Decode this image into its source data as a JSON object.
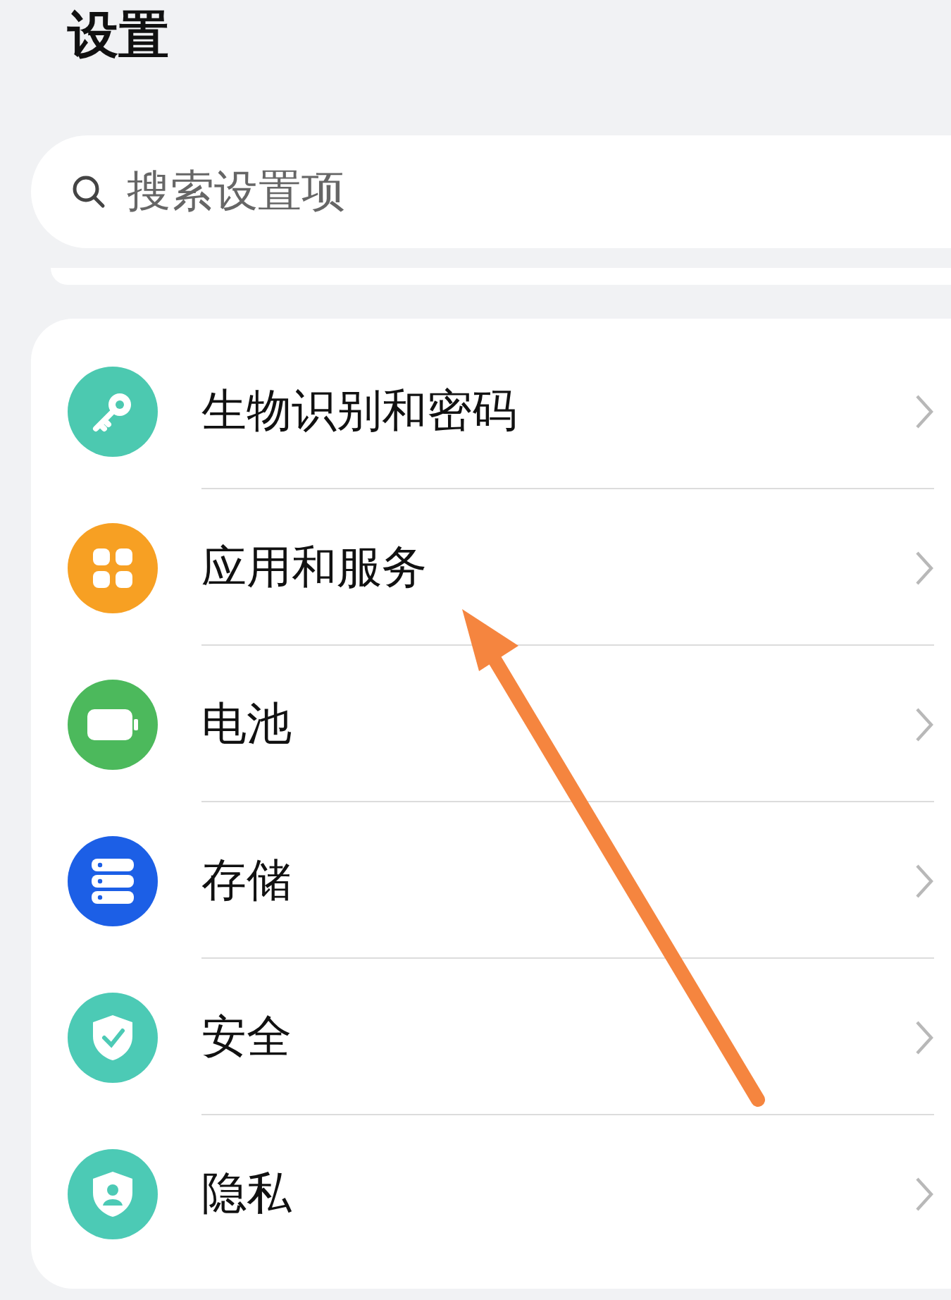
{
  "title": "设置",
  "search": {
    "placeholder": "搜索设置项"
  },
  "items": [
    {
      "label": "生物识别和密码",
      "color": "#4cc9b0"
    },
    {
      "label": "应用和服务",
      "color": "#f7a023"
    },
    {
      "label": "电池",
      "color": "#4cb95c"
    },
    {
      "label": "存储",
      "color": "#1c5fe6"
    },
    {
      "label": "安全",
      "color": "#4ccab5"
    },
    {
      "label": "隐私",
      "color": "#4ccab5"
    }
  ]
}
